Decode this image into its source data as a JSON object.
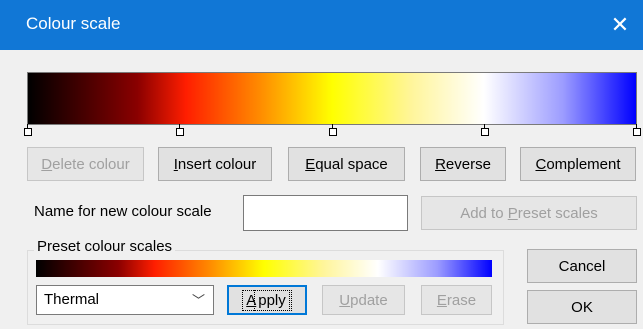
{
  "window": {
    "title": "Colour scale",
    "close_glyph": "✕"
  },
  "scale": {
    "stops": [
      "#000000",
      "#ff1e00",
      "#ffff00",
      "#ffffff",
      "#0000ff"
    ]
  },
  "buttons": {
    "delete_colour": {
      "label": "Delete colour",
      "accel": "D",
      "rest": "elete colour"
    },
    "insert_colour": {
      "label": "Insert colour",
      "accel": "I",
      "rest": "nsert colour"
    },
    "equal_space": {
      "label": "Equal space",
      "accel": "E",
      "rest": "qual space"
    },
    "reverse": {
      "label": "Reverse",
      "accel": "R",
      "rest": "everse"
    },
    "complement": {
      "label": "Complement",
      "accel": "C",
      "rest": "omplement"
    },
    "add_to_preset": {
      "label": "Add to Preset scales",
      "pre": "Add to ",
      "accel": "P",
      "rest": "reset scales"
    },
    "apply": {
      "label": "Apply",
      "accel": "A",
      "rest": "pply"
    },
    "update": {
      "label": "Update",
      "accel": "U",
      "rest": "pdate"
    },
    "erase": {
      "label": "Erase",
      "accel": "E",
      "rest": "rase"
    },
    "cancel": {
      "label": "Cancel"
    },
    "ok": {
      "label": "OK"
    }
  },
  "new_scale": {
    "label": "Name for new colour scale",
    "value": ""
  },
  "preset": {
    "group_label": "Preset colour scales",
    "selected": "Thermal"
  },
  "icons": {
    "close": "close-icon",
    "dropdown": "chevron-down-icon"
  }
}
